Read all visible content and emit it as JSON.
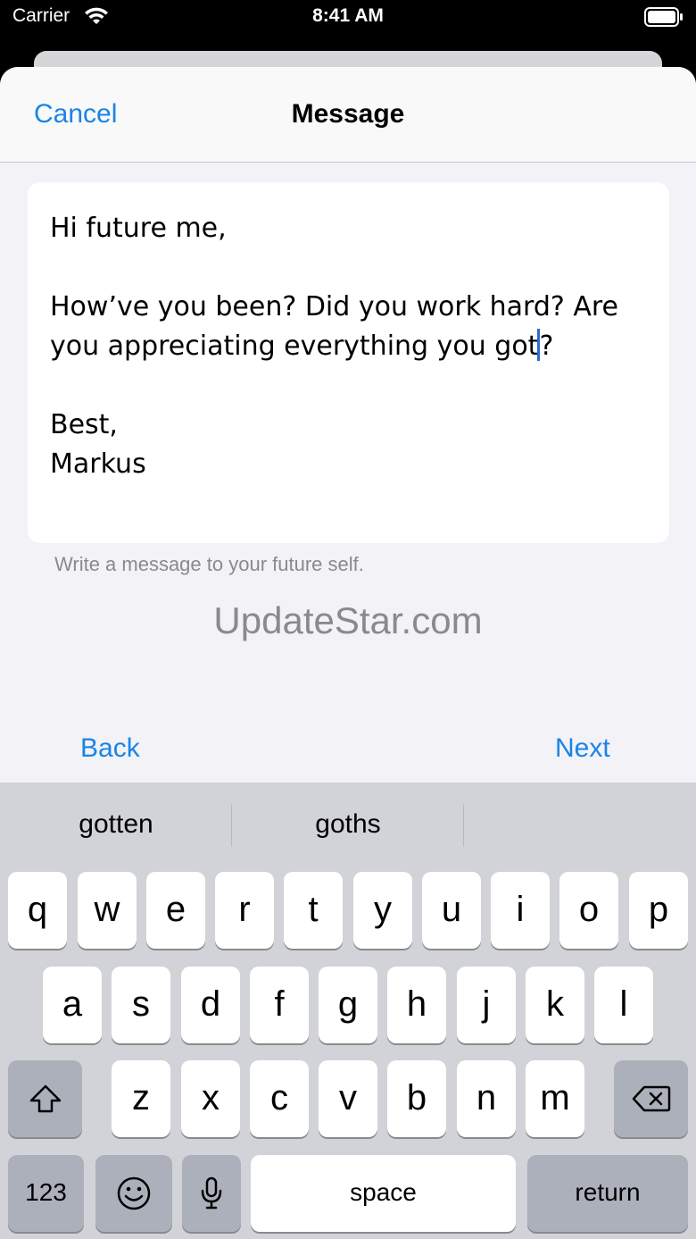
{
  "status_bar": {
    "carrier": "Carrier",
    "time": "8:41 AM"
  },
  "nav": {
    "cancel_label": "Cancel",
    "title": "Message"
  },
  "message": {
    "before_cursor": "Hi future me,\n\nHow’ve you been? Did you work hard? Are you appreciating everything you got",
    "after_cursor": "?\n\nBest,\nMarkus"
  },
  "hint": "Write a message to your future self.",
  "watermark": "UpdateStar.com",
  "footer": {
    "back_label": "Back",
    "next_label": "Next"
  },
  "keyboard": {
    "suggestions": [
      "gotten",
      "goths",
      ""
    ],
    "row1": [
      "q",
      "w",
      "e",
      "r",
      "t",
      "y",
      "u",
      "i",
      "o",
      "p"
    ],
    "row2": [
      "a",
      "s",
      "d",
      "f",
      "g",
      "h",
      "j",
      "k",
      "l"
    ],
    "row3": [
      "z",
      "x",
      "c",
      "v",
      "b",
      "n",
      "m"
    ],
    "numbers_label": "123",
    "space_label": "space",
    "return_label": "return",
    "icons": {
      "shift": "shift-icon",
      "delete": "delete-icon",
      "emoji": "emoji-icon",
      "mic": "microphone-icon"
    }
  },
  "colors": {
    "accent": "#1a84e6",
    "cursor": "#2a6cd6",
    "keyboard_bg": "#d1d3d9"
  }
}
